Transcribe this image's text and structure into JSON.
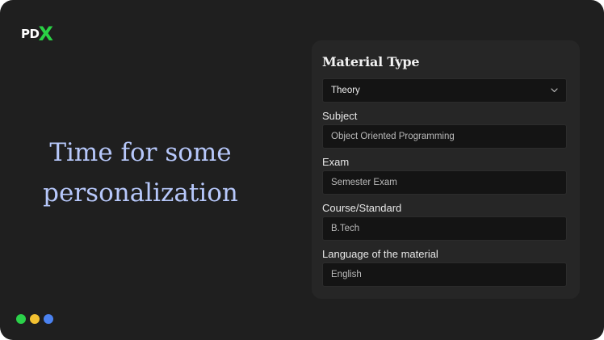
{
  "brand": {
    "logo_prefix": "PD",
    "logo_mark": "X",
    "accent": "#2ad145"
  },
  "hero": {
    "line1": "Time for some",
    "line2": "personalization",
    "color": "#b7c8fb"
  },
  "form": {
    "title": "Material Type",
    "material_type": {
      "selected": "Theory",
      "icon": "chevron-down-icon"
    },
    "subject": {
      "label": "Subject",
      "value": "Object Oriented Programming"
    },
    "exam": {
      "label": "Exam",
      "value": "Semester Exam"
    },
    "course": {
      "label": "Course/Standard",
      "value": "B.Tech"
    },
    "language": {
      "label": "Language of the material",
      "value": "English"
    }
  },
  "progress_dots": [
    {
      "color": "#2bd14a"
    },
    {
      "color": "#f3c131"
    },
    {
      "color": "#4b82f0"
    }
  ]
}
